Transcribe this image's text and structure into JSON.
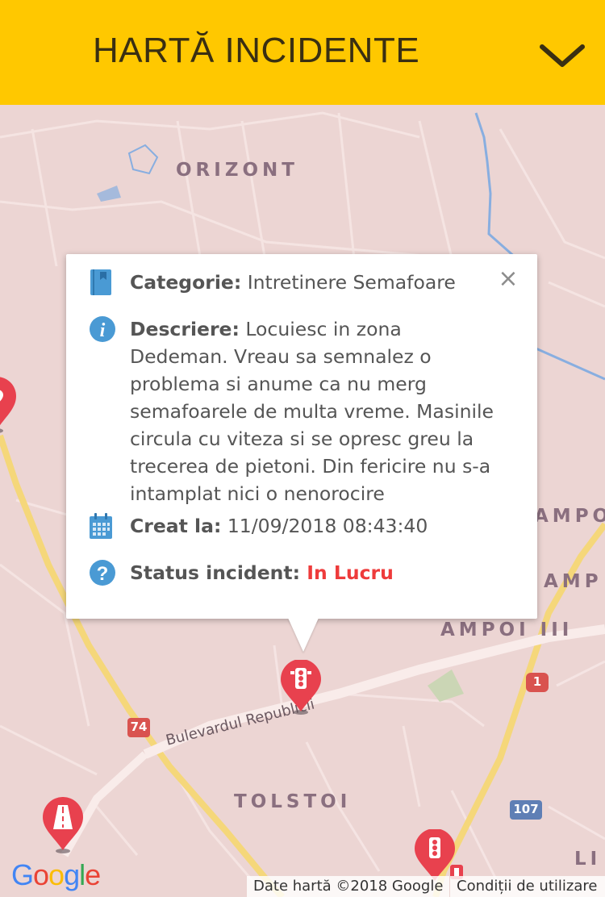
{
  "header": {
    "title": "HARTĂ INCIDENTE",
    "toggle_icon": "chevron-down-icon"
  },
  "map": {
    "areas": [
      "ORIZONT",
      "AMPOI",
      "AMP",
      "AMPOI III",
      "TOLSTOI",
      "LI"
    ],
    "street": "Bulevardul Republicii",
    "road_shields": [
      "74",
      "1",
      "107"
    ],
    "colors": {
      "background": "#ecd5d3",
      "major_road": "#f5d77a",
      "water": "#88aee0",
      "pin": "#e8414e"
    },
    "logo": "Google",
    "attribution": {
      "map_data": "Date hartă ©2018 Google",
      "terms": "Condiții de utilizare"
    }
  },
  "popup": {
    "category": {
      "icon": "book-icon",
      "label": "Categorie:",
      "value": " Intretinere Semafoare"
    },
    "description": {
      "icon": "info-icon",
      "label": "Descriere:",
      "value": " Locuiesc in zona Dedeman. Vreau sa semnalez o problema si anume ca nu merg semafoarele de multa vreme. Masinile circula cu viteza si se opresc greu la trecerea de pietoni. Din fericire nu s-a intamplat nici o nenorocire"
    },
    "created": {
      "icon": "calendar-icon",
      "label": "Creat la:",
      "value": " 11/09/2018 08:43:40"
    },
    "status": {
      "icon": "help-icon",
      "label": "Status incident:",
      "value": " In Lucru",
      "color": "#ee3b3b"
    },
    "close_icon": "close-icon"
  }
}
